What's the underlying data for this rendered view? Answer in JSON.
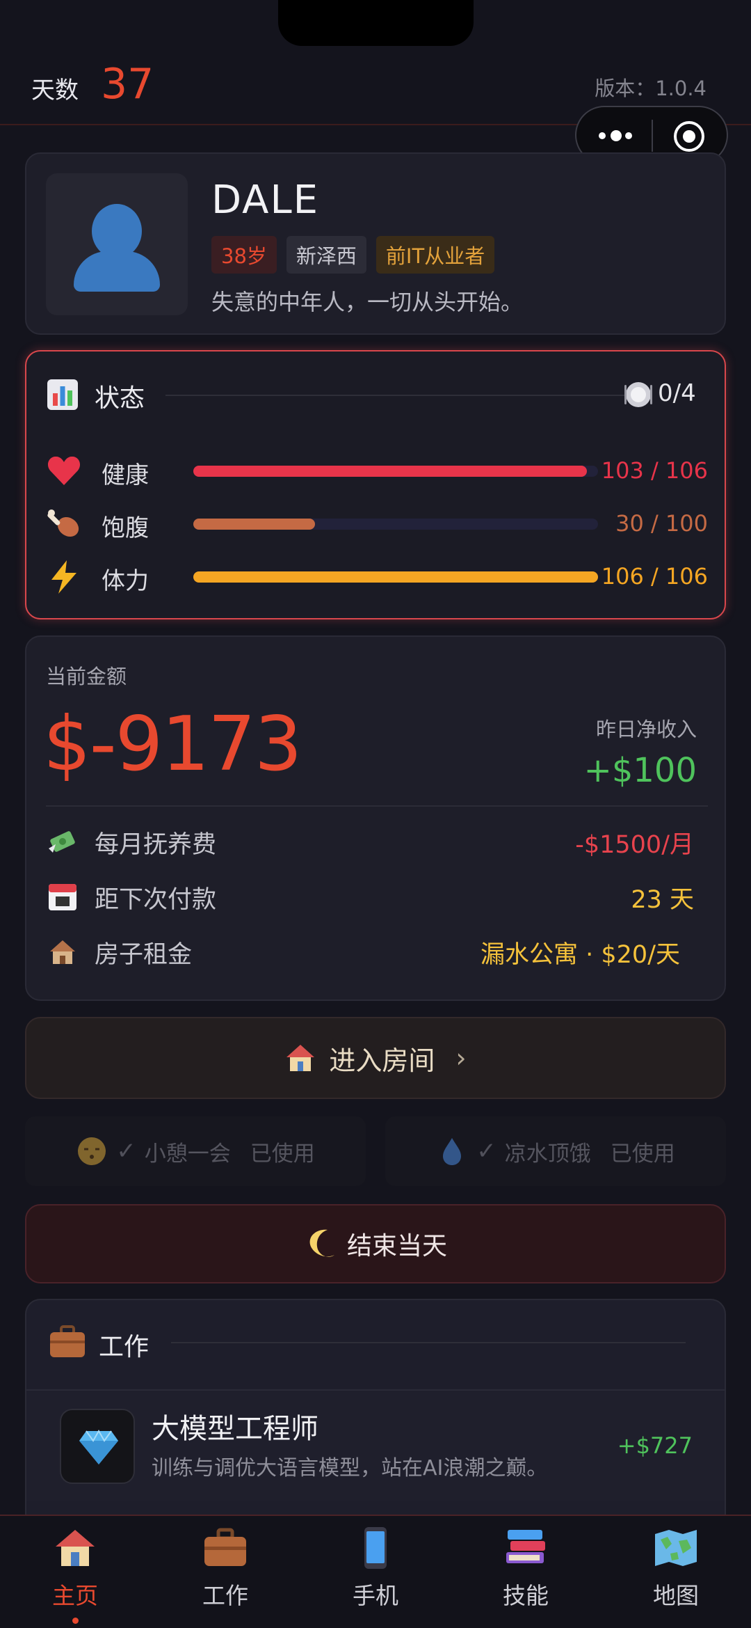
{
  "header": {
    "day_label": "天数",
    "day_value": "37",
    "version": "版本：1.0.4"
  },
  "profile": {
    "name": "DALE",
    "tags": [
      "38岁",
      "新泽西",
      "前IT从业者"
    ],
    "bio": "失意的中年人，一切从头开始。"
  },
  "status": {
    "title": "状态",
    "meal_count": "0/4",
    "bars": [
      {
        "label": "健康",
        "value": "103 / 106",
        "current": 103,
        "max": 106,
        "color": "#e8344a"
      },
      {
        "label": "饱腹",
        "value": "30 / 100",
        "current": 30,
        "max": 100,
        "color": "#c56a44"
      },
      {
        "label": "体力",
        "value": "106 / 106",
        "current": 106,
        "max": 106,
        "color": "#f5a623"
      }
    ]
  },
  "money": {
    "label": "当前金额",
    "amount": "$-9173",
    "yesterday_label": "昨日净收入",
    "yesterday_value": "+$100",
    "rows": [
      {
        "icon": "money-wings-icon",
        "label": "每月抚养费",
        "value": "-$1500/月",
        "color": "#e8434d"
      },
      {
        "icon": "calendar-icon",
        "label": "距下次付款",
        "value": "23 天",
        "color": "#f5c23b"
      },
      {
        "icon": "derelict-house-icon",
        "label": "房子租金",
        "value": "漏水公寓 · $20/天",
        "color": "#f5c23b"
      }
    ]
  },
  "enter_room": {
    "label": "进入房间"
  },
  "used_actions": [
    {
      "label": "小憩一会",
      "status": "已使用",
      "icon": "sleepy-face-icon"
    },
    {
      "label": "凉水顶饿",
      "status": "已使用",
      "icon": "droplet-icon"
    }
  ],
  "end_day": {
    "label": "结束当天"
  },
  "work": {
    "title": "工作",
    "job": {
      "title": "大模型工程师",
      "desc": "训练与调优大语言模型，站在AI浪潮之巅。",
      "pay": "+$727"
    }
  },
  "tabs": [
    {
      "label": "主页",
      "icon": "house-icon",
      "active": true
    },
    {
      "label": "工作",
      "icon": "briefcase-icon",
      "active": false
    },
    {
      "label": "手机",
      "icon": "phone-icon",
      "active": false
    },
    {
      "label": "技能",
      "icon": "books-icon",
      "active": false
    },
    {
      "label": "地图",
      "icon": "map-icon",
      "active": false
    }
  ]
}
